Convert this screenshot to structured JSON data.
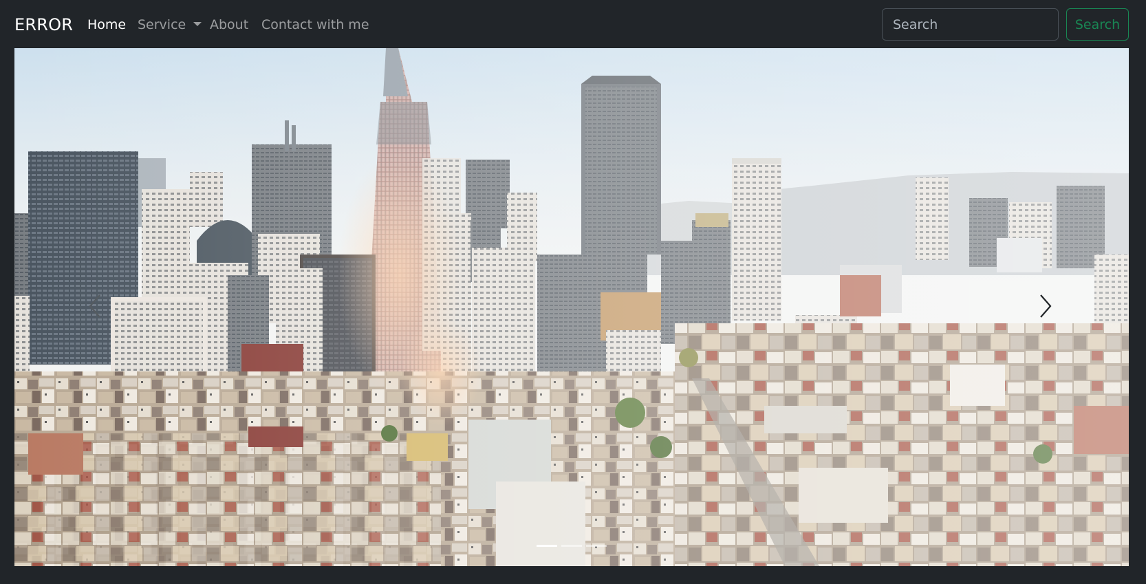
{
  "navbar": {
    "brand": "ERROR",
    "links": [
      {
        "label": "Home",
        "active": true
      },
      {
        "label": "Service",
        "dropdown": true
      },
      {
        "label": "About"
      },
      {
        "label": "Contact with me"
      }
    ],
    "search": {
      "placeholder": "Search",
      "value": "",
      "button_label": "Search"
    }
  },
  "carousel": {
    "slide": "city-skyline-photo",
    "controls": {
      "prev_icon": "chevron-left-icon",
      "next_icon": "chevron-right-icon"
    },
    "slide_count": 3,
    "active_index": 0
  },
  "colors": {
    "background": "#212529",
    "nav_text": "#ffffff",
    "nav_muted": "#8c8f92",
    "search_outline": "#198754"
  }
}
